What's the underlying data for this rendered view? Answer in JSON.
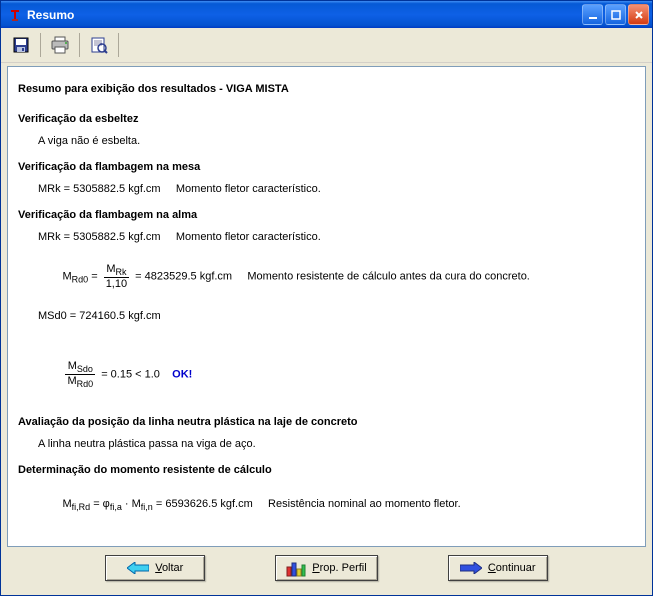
{
  "titlebar": {
    "title": "Resumo"
  },
  "toolbar": {
    "save": "save-icon",
    "print": "print-icon",
    "preview": "preview-icon"
  },
  "report": {
    "title": "Resumo para exibição dos resultados - VIGA MISTA",
    "esbeltez": {
      "heading": "Verificação da esbeltez",
      "line1": "A viga não é esbelta."
    },
    "flamb_mesa": {
      "heading": "Verificação da flambagem na mesa",
      "line1": "MRk = 5305882.5 kgf.cm     Momento fletor característico."
    },
    "flamb_alma": {
      "heading": "Verificação da flambagem na alma",
      "line1": "MRk = 5305882.5 kgf.cm     Momento fletor característico.",
      "mrd0_prefix": "M",
      "mrd0_sub": "Rd0",
      "mrd0_eq": " = ",
      "mrd0_frac_num": "M",
      "mrd0_frac_num_sub": "Rk",
      "mrd0_frac_den": "1,10",
      "mrd0_val": " = 4823529.5 kgf.cm     Momento resistente de cálculo antes da cura do concreto.",
      "msd0": "MSd0 = 724160.5 kgf.cm",
      "ratio_num": "M",
      "ratio_num_sub": "Sdo",
      "ratio_den": "M",
      "ratio_den_sub": "Rd0",
      "ratio_val": " = 0.15 < 1.0    ",
      "ratio_ok": "OK!"
    },
    "linha_neutra": {
      "heading": "Avaliação da posição da linha neutra plástica na laje de concreto",
      "line1": "A linha neutra plástica passa na viga de aço."
    },
    "momento_res": {
      "heading": "Determinação do momento resistente de cálculo",
      "m_prefix": "M",
      "m_sub1": "fi,Rd",
      "eq1": " = φ",
      "phi_sub": "fi,a",
      "dot": " · M",
      "m_sub2": "fi,n",
      "val": " = 6593626.5 kgf.cm     Resistência nominal ao momento fletor."
    }
  },
  "buttons": {
    "back": "Voltar",
    "back_u": "V",
    "back_rest": "oltar",
    "profile": "Prop. Perfil",
    "profile_u": "P",
    "profile_rest": "rop. Perfil",
    "continue": "Continuar",
    "continue_u": "C",
    "continue_rest": "ontinuar"
  }
}
